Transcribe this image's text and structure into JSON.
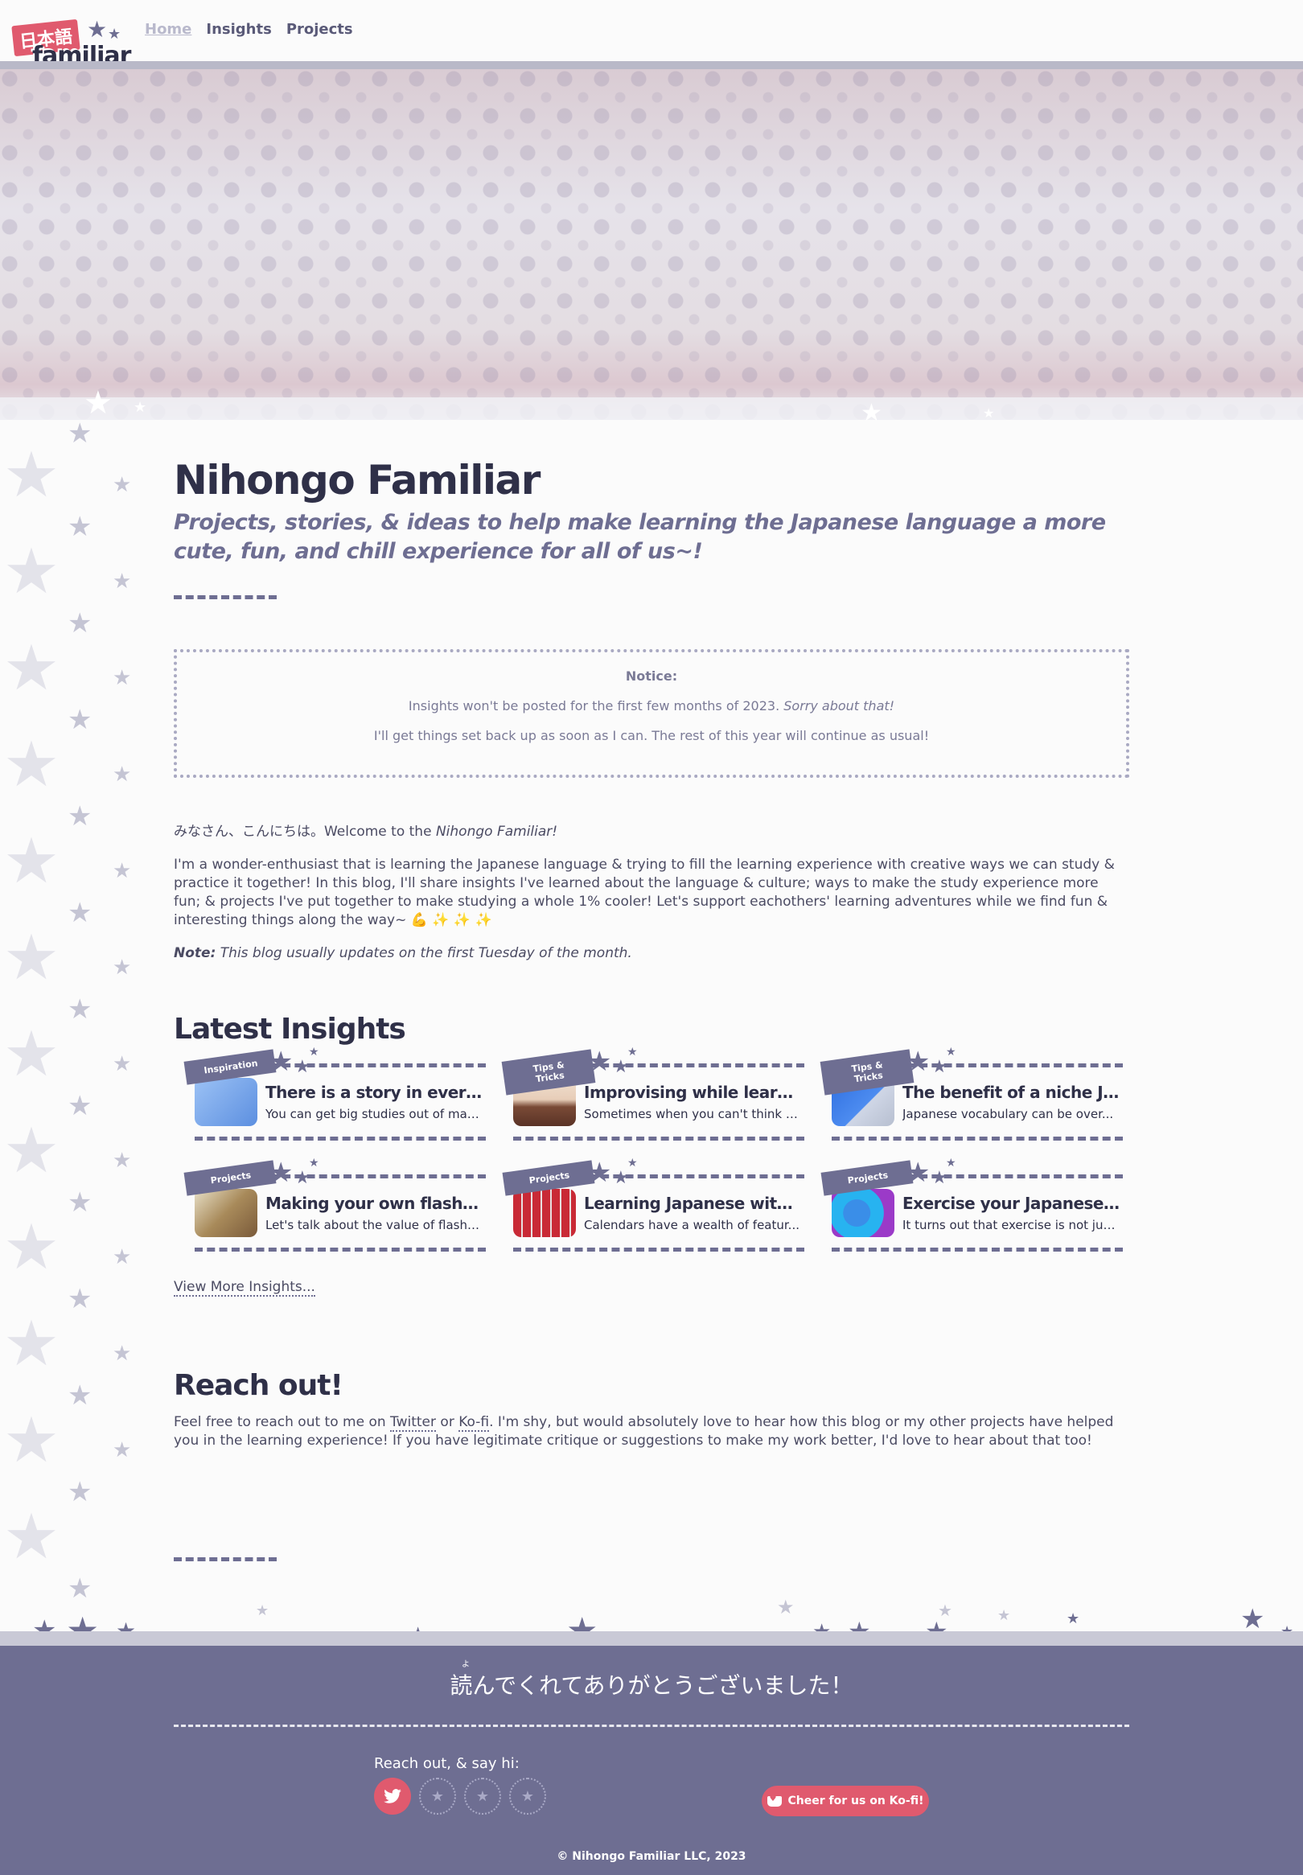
{
  "logo": {
    "jp": "日本語",
    "en": "familiar"
  },
  "nav": {
    "links": [
      "Home",
      "Insights",
      "Projects"
    ]
  },
  "site": {
    "title": "Nihongo Familiar",
    "tagline": "Projects, stories, & ideas to help make learning the Japanese language a more cute, fun, and chill experience for all of us~!"
  },
  "notice": {
    "title": "Notice:",
    "line1": "Insights won't be posted for the first few months of 2023.",
    "line1_em": "Sorry about that!",
    "line2": "I'll get things set back up as soon as I can. The rest of this year will continue as usual!"
  },
  "intro": {
    "greeting": "みなさん、こんにちは。Welcome to the",
    "greeting_em": "Nihongo Familiar!",
    "body": "I'm a wonder-enthusiast that is learning the Japanese language & trying to fill the learning experience with creative ways we can study & practice it together! In this blog, I'll share insights I've learned about the language & culture; ways to make the study experience more fun; & projects I've put together to make studying a whole 1% cooler! Let's support eachothers' learning adventures while we find fun & interesting things along the way~ 💪 ✨ ✨ ✨",
    "note_label": "Note:",
    "note_text": "This blog usually updates on the first Tuesday of the month."
  },
  "insights": {
    "heading": "Latest Insights",
    "cards": [
      {
        "tag": "Inspiration",
        "title": "There is a story in every ...",
        "excerpt": "You can get big studies out of maki...",
        "thumb": "kanji-notes"
      },
      {
        "tag": "Tips & Tricks",
        "title": "Improvising while learnin...",
        "excerpt": "Sometimes when you can't think o...",
        "thumb": "shop-sign"
      },
      {
        "tag": "Tips & Tricks",
        "title": "The benefit of a niche Ja...",
        "excerpt": "Japanese vocabulary can be over...",
        "thumb": "sea-character"
      },
      {
        "tag": "Projects",
        "title": "Making your own flashca...",
        "excerpt": "Let's talk about the value of flashc...",
        "thumb": "flashcards"
      },
      {
        "tag": "Projects",
        "title": "Learning Japanese with ...",
        "excerpt": "Calendars have a wealth of featur...",
        "thumb": "calendar"
      },
      {
        "tag": "Projects",
        "title": "Exercise your Japanese s...",
        "excerpt": "It turns out that exercise is not just ...",
        "thumb": "globe-exercise"
      }
    ],
    "view_more": "View More Insights..."
  },
  "reach": {
    "heading": "Reach out!",
    "text_before": "Feel free to reach out to me on",
    "twitter": "Twitter",
    "or": "or",
    "kofi": "Ko-fi",
    "text_after": ". I'm shy, but would absolutely love to hear how this blog or my other projects have helped you in the learning experience! If you have legitimate critique or suggestions to make my work better, I'd love to hear about that too!"
  },
  "footer": {
    "ruby": "よ",
    "thanks": "読んでくれてありがとうございました！",
    "say_hi": "Reach out, & say hi:",
    "social": [
      "twitter-icon",
      "star-icon",
      "star-icon",
      "star-icon"
    ],
    "kofi_button": "Cheer for us on Ko-fi!",
    "copyright": "© Nihongo Familiar LLC, 2023"
  },
  "colors": {
    "accent": "#6e6e92",
    "pink": "#e05a6e",
    "dark": "#2f3048",
    "bg": "#fbfbfb"
  }
}
